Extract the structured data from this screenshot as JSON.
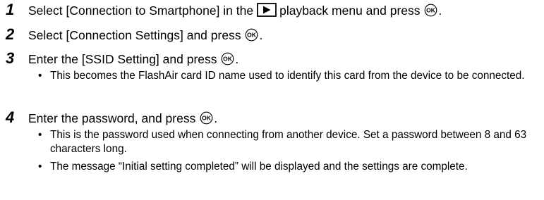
{
  "steps": [
    {
      "number": "1",
      "text_before": "Select [Connection to Smartphone] in the",
      "icon_playback": "playback-icon",
      "text_after": "playback menu and press",
      "icon_ok": "ok-button-icon",
      "end": "."
    },
    {
      "number": "2",
      "text": "Select [Connection Settings] and press",
      "icon_ok": "ok-button-icon",
      "end": "."
    },
    {
      "number": "3",
      "text": "Enter the [SSID Setting] and press",
      "icon_ok": "ok-button-icon",
      "end": ".",
      "bullets": [
        "This becomes the FlashAir card ID name used to identify this card from the device to be connected."
      ]
    },
    {
      "number": "4",
      "text": "Enter the password, and press",
      "icon_ok": "ok-button-icon",
      "end": ".",
      "bullets": [
        "This is the password used when connecting from another device. Set a password between 8 and 63 characters long.",
        "The message “Initial setting completed” will be displayed and the settings are complete."
      ]
    }
  ],
  "bullet_glyph": "•"
}
